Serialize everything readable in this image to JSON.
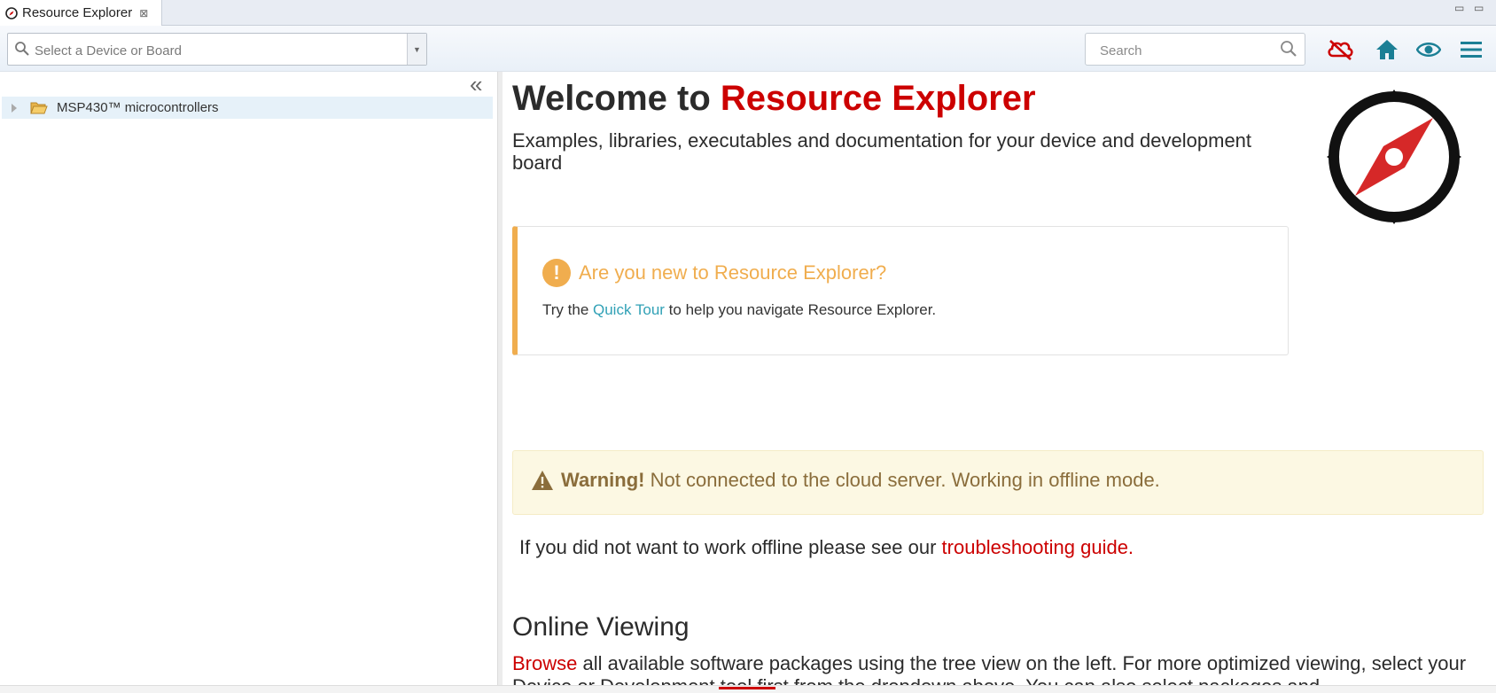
{
  "tab": {
    "title": "Resource Explorer",
    "close_glyph": "⊠"
  },
  "window_controls": {
    "minimize": "▭",
    "maximize": "▭"
  },
  "toolbar": {
    "device_select_placeholder": "Select a Device or Board",
    "search_placeholder": "Search",
    "icons": [
      "cloud-offline-icon",
      "home-icon",
      "eye-icon",
      "menu-icon"
    ],
    "cloud_icon_color": "#cc0000",
    "icon_color": "#1b7f95"
  },
  "sidebar": {
    "collapse_glyph": "«",
    "tree": [
      {
        "label": "MSP430™ microcontrollers"
      }
    ]
  },
  "main": {
    "welcome_prefix": "Welcome to ",
    "welcome_accent": "Resource Explorer",
    "subtitle": "Examples, libraries, executables and documentation for your device and development board",
    "tour": {
      "icon_glyph": "!",
      "title": "Are you new to Resource Explorer?",
      "text_before": "Try the ",
      "link": "Quick Tour",
      "text_after": " to help you navigate Resource Explorer."
    },
    "warning": {
      "bold": "Warning!",
      "text": " Not connected to the cloud server. Working in offline mode."
    },
    "offline": {
      "text": "If you did not want to work offline please see our ",
      "link": "troubleshooting guide."
    },
    "online_heading": "Online Viewing",
    "browse": {
      "link": "Browse",
      "text": " all available software packages using the tree view on the left. For more optimized viewing, select your Device or Development tool first from the dropdown above. You can also select packages and"
    }
  },
  "colors": {
    "accent_red": "#cc0000",
    "warning_orange": "#f0ad4e",
    "teal": "#31a1b6"
  }
}
